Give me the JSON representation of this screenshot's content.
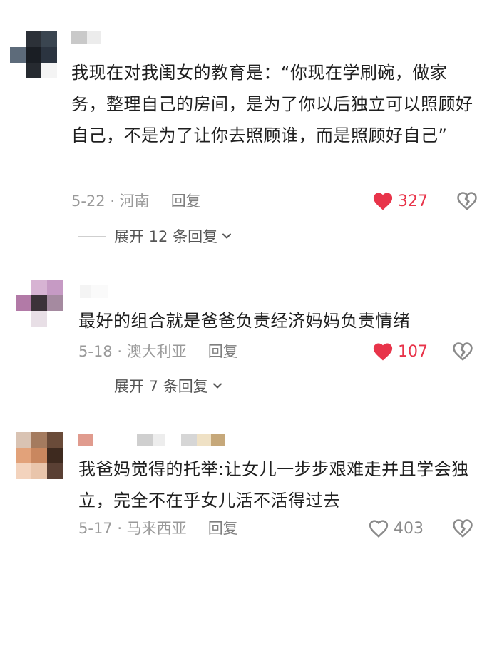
{
  "comments": [
    {
      "text": "我现在对我闺女的教育是：“你现在学刷碗，做家务，整理自己的房间，是为了你以后独立可以照顾好自己，不是为了让你去照顾谁，而是照顾好自己”",
      "date_location": "5-22 · 河南",
      "reply_label": "回复",
      "likes": "327",
      "liked": true,
      "expand_label": "展开 12 条回复"
    },
    {
      "text": "最好的组合就是爸爸负责经济妈妈负责情绪",
      "date_location": "5-18 · 澳大利亚",
      "reply_label": "回复",
      "likes": "107",
      "liked": true,
      "expand_label": "展开 7 条回复"
    },
    {
      "text": "我爸妈觉得的托举:让女儿一步步艰难走并且学会独立，完全不在乎女儿活不活得过去",
      "date_location": "5-17 · 马来西亚",
      "reply_label": "回复",
      "likes": "403",
      "liked": false,
      "expand_label": ""
    }
  ],
  "colors": {
    "like_active": "#e8344a",
    "meta_text": "#9a9a9a"
  }
}
